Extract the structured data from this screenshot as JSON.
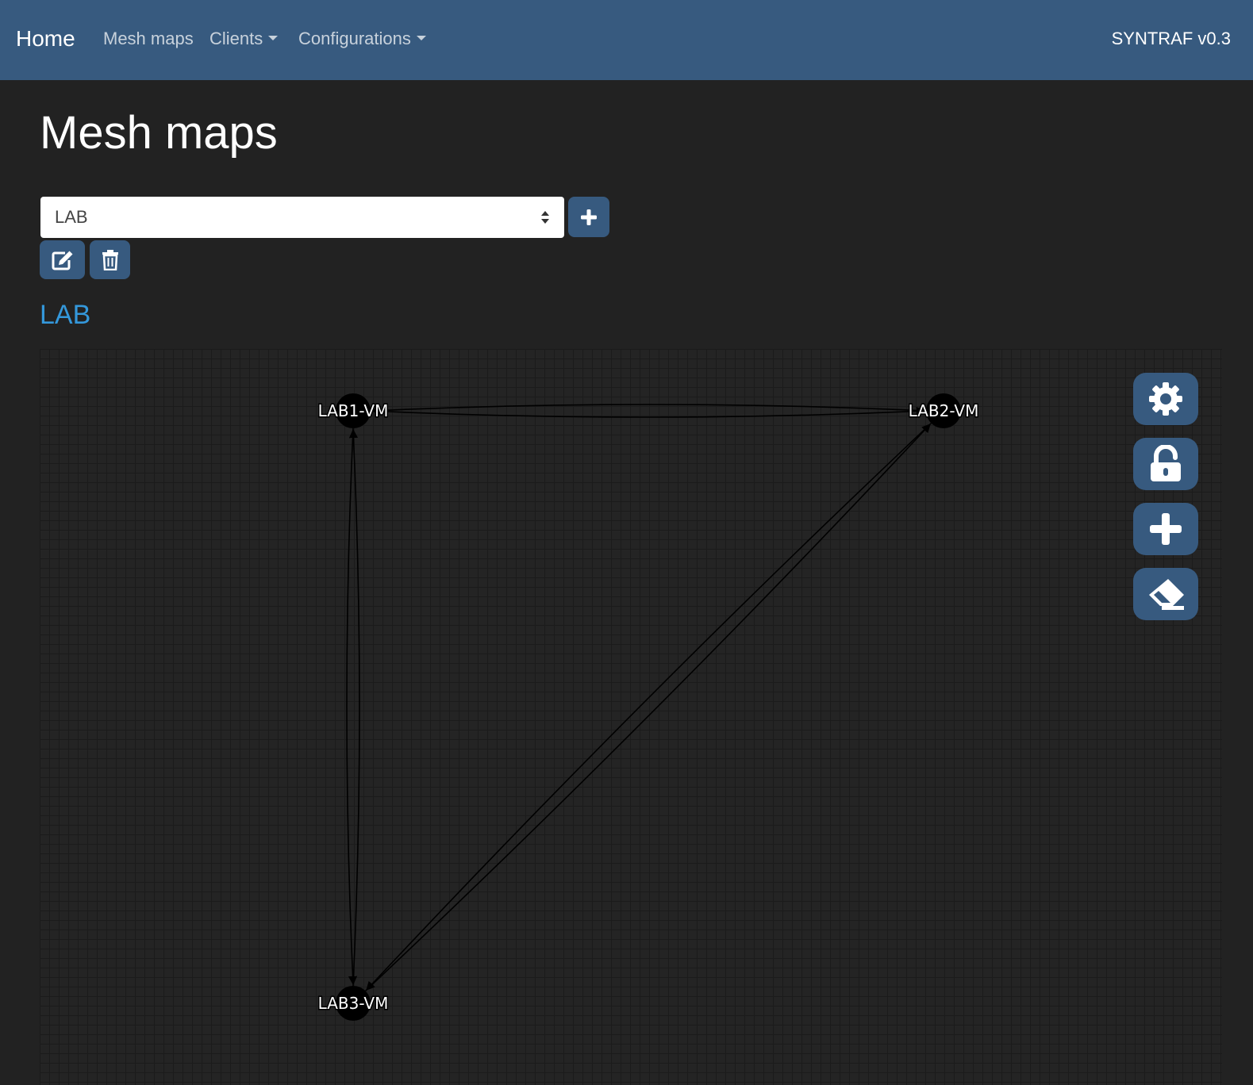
{
  "navbar": {
    "brand": "Home",
    "links": [
      {
        "label": "Mesh maps",
        "dropdown": false
      },
      {
        "label": "Clients",
        "dropdown": true
      },
      {
        "label": "Configurations",
        "dropdown": true
      }
    ],
    "version": "SYNTRAF v0.3",
    "bg_color": "#375a7f"
  },
  "page": {
    "title": "Mesh maps"
  },
  "map_select": {
    "selected": "LAB"
  },
  "actions": {
    "add_icon": "plus-icon",
    "edit_icon": "edit-icon",
    "delete_icon": "trash-icon"
  },
  "map": {
    "title": "LAB",
    "title_color": "#3498db",
    "nodes": [
      {
        "id": "LAB1-VM",
        "label": "LAB1-VM"
      },
      {
        "id": "LAB2-VM",
        "label": "LAB2-VM"
      },
      {
        "id": "LAB3-VM",
        "label": "LAB3-VM"
      }
    ],
    "edges": [
      {
        "from": "LAB1-VM",
        "to": "LAB2-VM"
      },
      {
        "from": "LAB2-VM",
        "to": "LAB1-VM"
      },
      {
        "from": "LAB1-VM",
        "to": "LAB3-VM"
      },
      {
        "from": "LAB3-VM",
        "to": "LAB1-VM"
      },
      {
        "from": "LAB2-VM",
        "to": "LAB3-VM"
      },
      {
        "from": "LAB3-VM",
        "to": "LAB2-VM"
      }
    ]
  },
  "toolbar": {
    "buttons": [
      {
        "icon": "gear-icon"
      },
      {
        "icon": "unlock-icon"
      },
      {
        "icon": "plus-icon"
      },
      {
        "icon": "eraser-icon"
      }
    ]
  }
}
